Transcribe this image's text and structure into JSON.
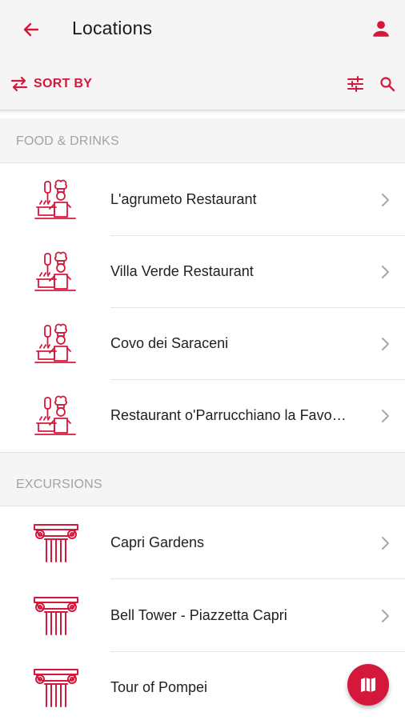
{
  "colors": {
    "accent": "#d6173c",
    "bar_bg": "#f5f5f5",
    "section_text": "#a3a3a3"
  },
  "appbar": {
    "title": "Locations",
    "back_icon": "arrow-left-icon",
    "user_icon": "person-icon"
  },
  "toolbar": {
    "sort_label": "SORT BY",
    "sort_icon": "swap-arrows-icon",
    "filter_icon": "sliders-icon",
    "search_icon": "search-icon"
  },
  "sections": [
    {
      "title": "FOOD & DRINKS",
      "icon": "chef-icon",
      "items": [
        {
          "label": "L'agrumeto Restaurant"
        },
        {
          "label": "Villa Verde Restaurant"
        },
        {
          "label": "Covo dei Saraceni"
        },
        {
          "label": "Restaurant o'Parrucchiano la Favo…"
        }
      ]
    },
    {
      "title": "EXCURSIONS",
      "icon": "column-capital-icon",
      "items": [
        {
          "label": "Capri Gardens"
        },
        {
          "label": "Bell Tower - Piazzetta Capri"
        },
        {
          "label": "Tour of Pompei"
        }
      ]
    }
  ],
  "fab": {
    "icon": "map-icon"
  }
}
